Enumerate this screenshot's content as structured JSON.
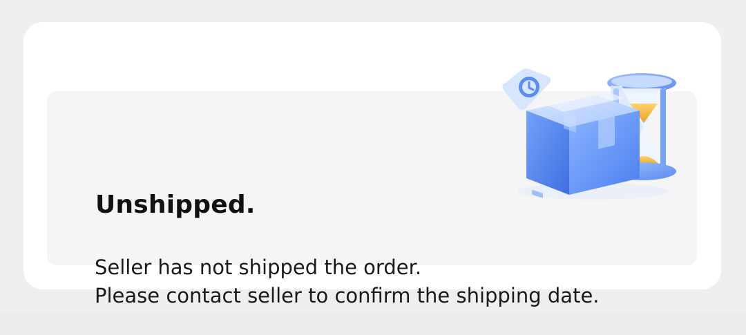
{
  "status": {
    "title": "Unshipped.",
    "message_line1": "Seller has not shipped the order.",
    "message_line2": "Please contact seller to confirm the shipping date."
  },
  "illustration": {
    "icons": [
      "package-box-icon",
      "hourglass-icon",
      "clock-icon"
    ],
    "accent_color": "#5b8def",
    "secondary_color": "#f0b23a"
  }
}
